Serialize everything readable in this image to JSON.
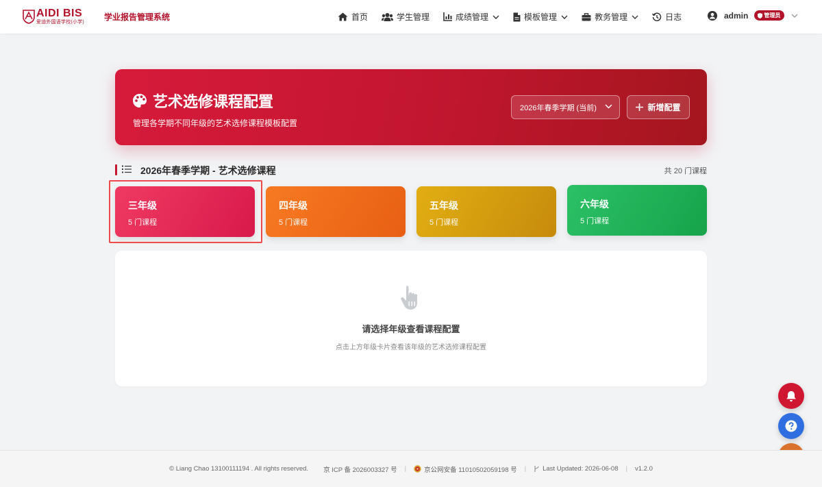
{
  "brand": {
    "name": "AIDI BIS",
    "subtitle": "爱迪外国语学校(小学)",
    "color": "#b3122b"
  },
  "system_title": "学业报告管理系统",
  "nav": {
    "items": [
      {
        "label": "首页",
        "icon": "home-icon",
        "has_dropdown": false
      },
      {
        "label": "学生管理",
        "icon": "users-icon",
        "has_dropdown": false
      },
      {
        "label": "成绩管理",
        "icon": "chart-icon",
        "has_dropdown": true
      },
      {
        "label": "模板管理",
        "icon": "file-icon",
        "has_dropdown": true
      },
      {
        "label": "教务管理",
        "icon": "briefcase-icon",
        "has_dropdown": true
      },
      {
        "label": "日志",
        "icon": "history-icon",
        "has_dropdown": false
      }
    ]
  },
  "user": {
    "name": "admin",
    "role": "管理员"
  },
  "hero": {
    "title": "艺术选修课程配置",
    "subtitle": "管理各学期不同年级的艺术选修课程模板配置",
    "term_select": "2026年春季学期 (当前)",
    "add_button": "新增配置"
  },
  "section": {
    "title": "2026年春季学期 - 艺术选修课程",
    "count": "共 20 门课程"
  },
  "grades": [
    {
      "name": "三年级",
      "count": "5 门课程",
      "color": "#e52a55",
      "selected": true
    },
    {
      "name": "四年级",
      "count": "5 门课程",
      "color": "#f0701c",
      "selected": false
    },
    {
      "name": "五年级",
      "count": "5 门课程",
      "color": "#d49c10",
      "selected": false
    },
    {
      "name": "六年级",
      "count": "5 门课程",
      "color": "#22b259",
      "selected": false
    }
  ],
  "empty_state": {
    "title": "请选择年级查看课程配置",
    "subtitle": "点击上方年级卡片查看该年级的艺术选修课程配置"
  },
  "footer": {
    "copyright": "© Liang Chao 13100111194 . All rights reserved.",
    "icp": "京 ICP 备 2026003327 号",
    "police": "京公网安备 11010502059198 号",
    "updated": "Last Updated: 2026-06-08",
    "version": "v1.2.0"
  }
}
